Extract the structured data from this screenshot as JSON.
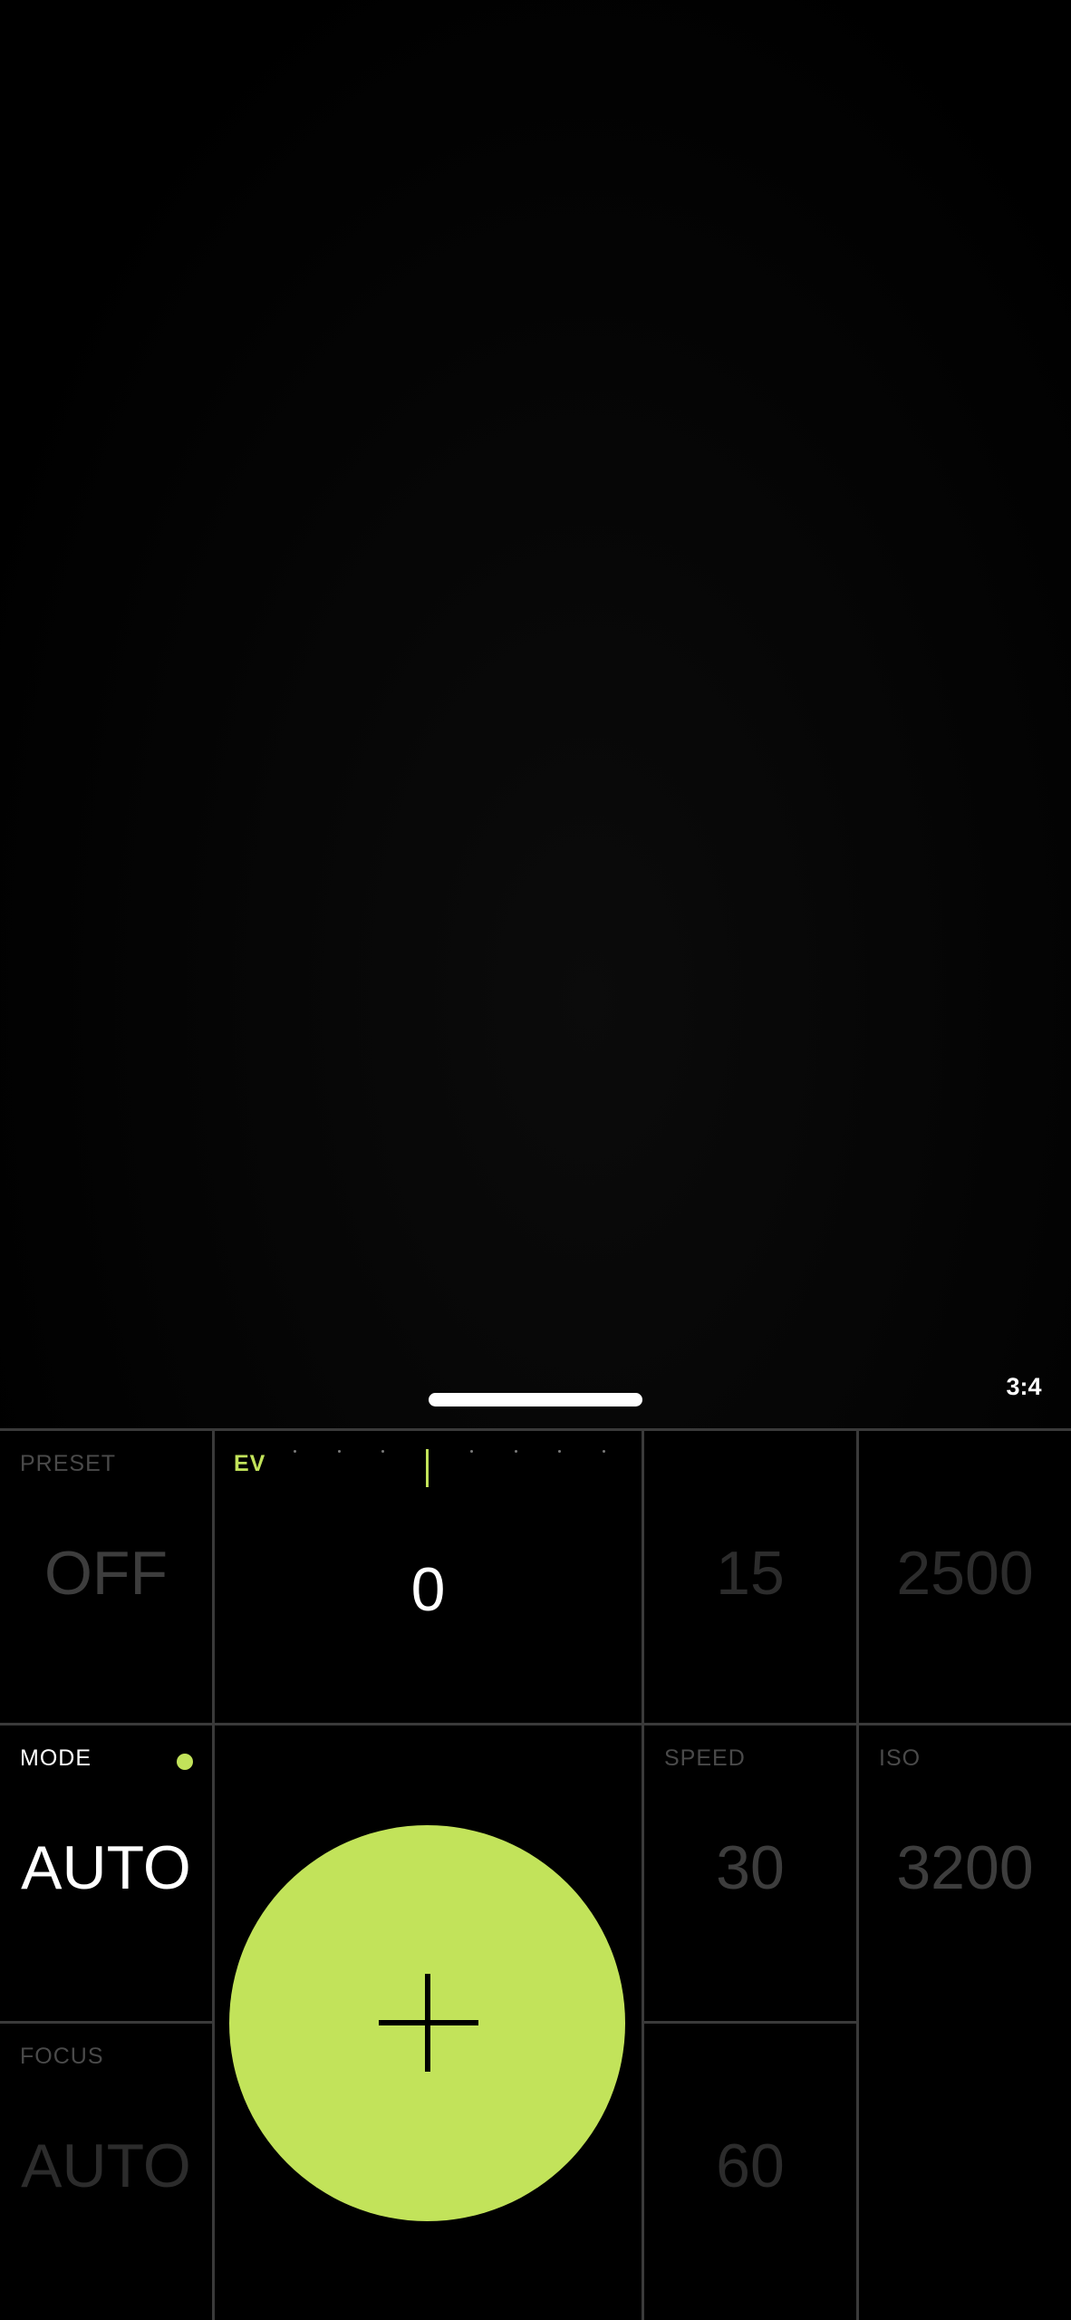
{
  "viewfinder": {
    "aspect_ratio": "3:4"
  },
  "preset": {
    "label": "PRESET",
    "value": "OFF"
  },
  "ev": {
    "label": "EV",
    "value": "0"
  },
  "top_speed_value": "15",
  "top_iso_value": "2500",
  "mode": {
    "label": "MODE",
    "value": "AUTO",
    "indicator_color": "#c2e35a"
  },
  "speed": {
    "label": "SPEED",
    "value": "30",
    "next_value": "60"
  },
  "iso": {
    "label": "ISO",
    "value": "3200"
  },
  "focus": {
    "label": "FOCUS",
    "value": "AUTO"
  },
  "shutter": {
    "color": "#c2e35a",
    "icon": "plus-icon"
  }
}
